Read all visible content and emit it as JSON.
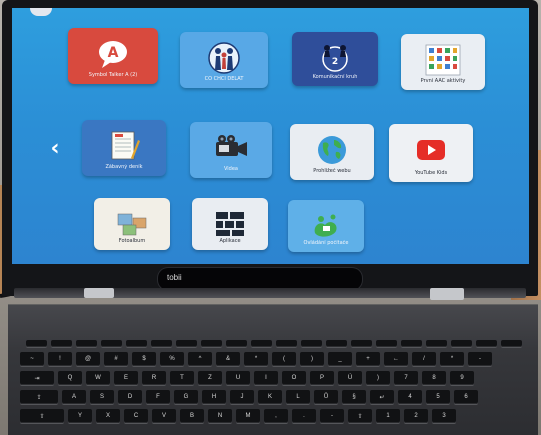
{
  "screen": {
    "nav_back_glyph": "‹",
    "tiles": [
      {
        "label": "Symbol Talker A (2)",
        "icon": "letter-a-speech-bubble-icon",
        "bg": "#d9463c",
        "symbol": "A"
      },
      {
        "label": "CO CHCI DĚLAT",
        "icon": "people-group-icon",
        "bg": "#4f9fe0"
      },
      {
        "label": "Komunikační kruh",
        "icon": "communication-circle-icon",
        "bg": "#2f4f9c"
      },
      {
        "label": "První AAC aktivity",
        "icon": "symbol-grid-icon",
        "bg": "#e9edf2"
      },
      {
        "label": "Zábavný deník",
        "icon": "diary-notebook-icon",
        "bg": "#3a78c4"
      },
      {
        "label": "Videa",
        "icon": "video-camera-icon",
        "bg": "#5aa9e6"
      },
      {
        "label": "Prohlížeč webu",
        "icon": "globe-browser-icon",
        "bg": "#e8ecf1"
      },
      {
        "label": "YouTube Kids",
        "icon": "youtube-play-icon",
        "bg": "#eef1f4"
      },
      {
        "label": "Fotoalbum",
        "icon": "photo-album-icon",
        "bg": "#f2efe7"
      },
      {
        "label": "Aplikace",
        "icon": "app-grid-icon",
        "bg": "#e9edf2"
      },
      {
        "label": "Ovládání počítače",
        "icon": "computer-control-icon",
        "bg": "#5fb0e8"
      }
    ]
  },
  "device": {
    "brand": "tobii"
  },
  "keyboard": {
    "row1": [
      "~",
      "!",
      "@",
      "#",
      "$",
      "%",
      "^",
      "&",
      "*",
      "(",
      ")",
      "_",
      "+",
      "←",
      "/",
      "*",
      "-"
    ],
    "row2": [
      "⇥",
      "Q",
      "W",
      "E",
      "R",
      "T",
      "Z",
      "U",
      "I",
      "O",
      "P",
      "Ú",
      ")",
      "7",
      "8",
      "9"
    ],
    "row3": [
      "⇪",
      "A",
      "S",
      "D",
      "F",
      "G",
      "H",
      "J",
      "K",
      "L",
      "Ů",
      "§",
      "↵",
      "4",
      "5",
      "6"
    ],
    "row4": [
      "⇧",
      "Y",
      "X",
      "C",
      "V",
      "B",
      "N",
      "M",
      ",",
      ".",
      "-",
      "⇧",
      "1",
      "2",
      "3"
    ]
  }
}
